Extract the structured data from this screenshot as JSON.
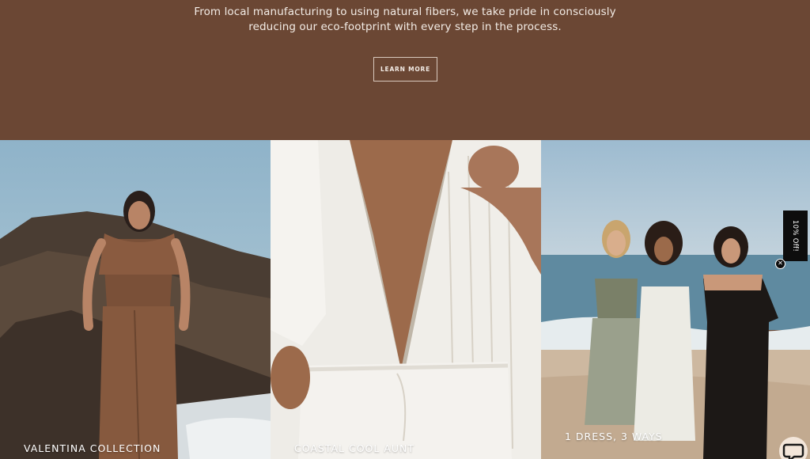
{
  "hero": {
    "line1": "From local manufacturing to using natural fibers, we take pride in consciously",
    "line2": "reducing our eco-footprint with every step in the process.",
    "button_label": "LEARN MORE"
  },
  "tiles": [
    {
      "label": "VALENTINA COLLECTION"
    },
    {
      "label": "COASTAL COOL AUNT"
    },
    {
      "label": "1 DRESS, 3 WAYS"
    }
  ],
  "discount_tab": {
    "label": "10% Off!"
  },
  "icons": {
    "close": "close-icon",
    "chat": "chat-icon"
  },
  "colors": {
    "hero_bg": "#6b4734",
    "text": "#f3ece6",
    "tab_bg": "#0d0d0d"
  }
}
